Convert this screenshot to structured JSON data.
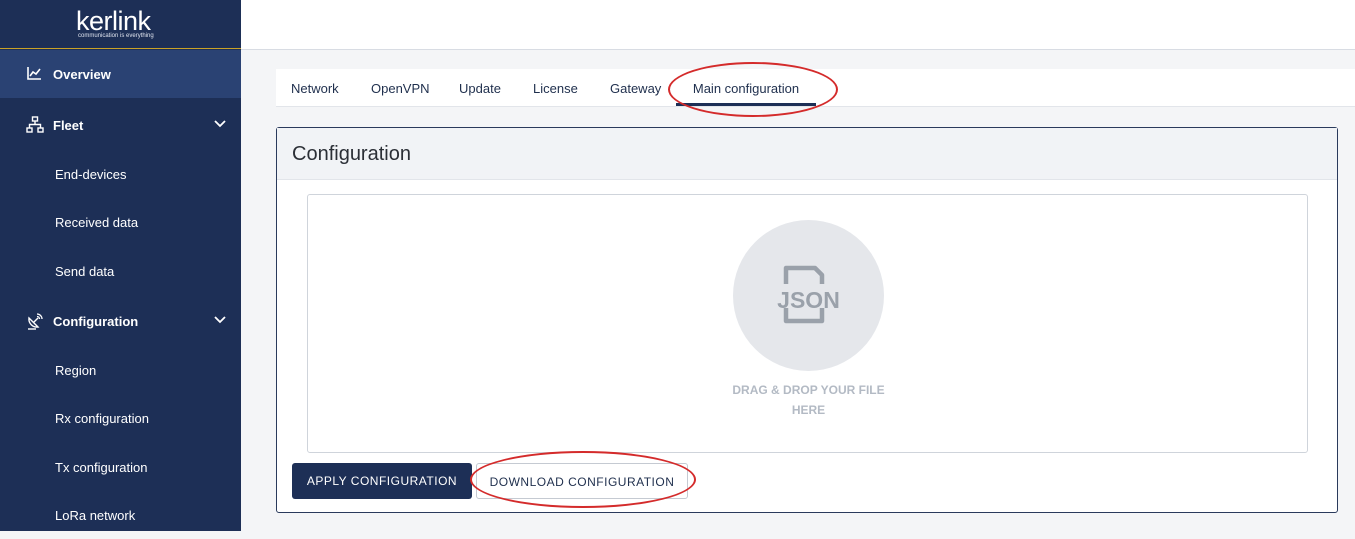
{
  "brand": {
    "logo": "kerlink",
    "tagline": "communication is everything"
  },
  "sidebar": {
    "items": [
      {
        "label": "Overview",
        "icon": "chart-line-icon",
        "active": true
      },
      {
        "label": "Fleet",
        "icon": "network-tree-icon",
        "expanded": true
      },
      {
        "label": "End-devices"
      },
      {
        "label": "Received data"
      },
      {
        "label": "Send data"
      },
      {
        "label": "Configuration",
        "icon": "satellite-dish-icon",
        "expanded": true
      },
      {
        "label": "Region"
      },
      {
        "label": "Rx configuration"
      },
      {
        "label": "Tx configuration"
      },
      {
        "label": "LoRa network"
      }
    ]
  },
  "tabs": [
    {
      "label": "Network"
    },
    {
      "label": "OpenVPN"
    },
    {
      "label": "Update"
    },
    {
      "label": "License"
    },
    {
      "label": "Gateway"
    },
    {
      "label": "Main configuration",
      "active": true
    }
  ],
  "card": {
    "title": "Configuration",
    "dropzone": {
      "icon": "json-file-icon",
      "line1": "DRAG & DROP YOUR FILE",
      "line2": "HERE"
    },
    "apply_label": "APPLY CONFIGURATION",
    "download_label": "DOWNLOAD CONFIGURATION"
  },
  "colors": {
    "sidebar": "#1d2f56",
    "sidebar_active": "#2a4273",
    "accent_line": "#c9a227",
    "highlight": "#d42b2b"
  }
}
